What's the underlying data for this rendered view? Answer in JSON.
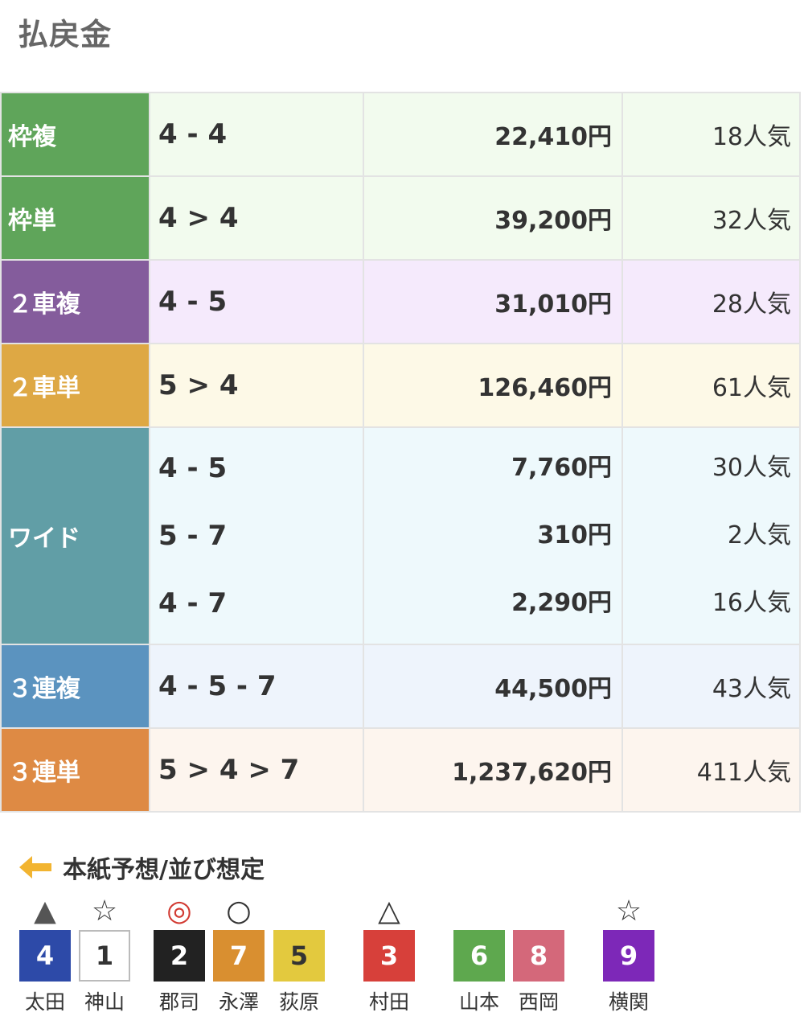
{
  "page_title": "払戻金",
  "payouts": [
    {
      "type": "枠複",
      "bg": "#5fa55a",
      "rowbg": "#f2fbee",
      "entries": [
        {
          "combo": "4 - 4",
          "amount": "22,410円",
          "popularity": "18人気"
        }
      ]
    },
    {
      "type": "枠単",
      "bg": "#5fa55a",
      "rowbg": "#f2fbee",
      "entries": [
        {
          "combo": "4 > 4",
          "amount": "39,200円",
          "popularity": "32人気"
        }
      ]
    },
    {
      "type": "２車複",
      "bg": "#845c9c",
      "rowbg": "#f5eafc",
      "entries": [
        {
          "combo": "4 - 5",
          "amount": "31,010円",
          "popularity": "28人気"
        }
      ]
    },
    {
      "type": "２車単",
      "bg": "#dea844",
      "rowbg": "#fdf9e7",
      "entries": [
        {
          "combo": "5 > 4",
          "amount": "126,460円",
          "popularity": "61人気"
        }
      ]
    },
    {
      "type": "ワイド",
      "bg": "#619ea6",
      "rowbg": "#eef9fc",
      "entries": [
        {
          "combo": "4 - 5",
          "amount": "7,760円",
          "popularity": "30人気"
        },
        {
          "combo": "5 - 7",
          "amount": "310円",
          "popularity": "2人気"
        },
        {
          "combo": "4 - 7",
          "amount": "2,290円",
          "popularity": "16人気"
        }
      ]
    },
    {
      "type": "３連複",
      "bg": "#5b93bf",
      "rowbg": "#eef4fc",
      "entries": [
        {
          "combo": "4 - 5 - 7",
          "amount": "44,500円",
          "popularity": "43人気"
        }
      ]
    },
    {
      "type": "３連単",
      "bg": "#de8a44",
      "rowbg": "#fdf5ee",
      "entries": [
        {
          "combo": "5 > 4 > 7",
          "amount": "1,237,620円",
          "popularity": "411人気"
        }
      ]
    }
  ],
  "prediction": {
    "title": "本紙予想/並び想定",
    "arrow_icon": "arrow-left-icon",
    "arrow_color": "#f2b430",
    "racers": [
      {
        "mark": "▲",
        "number": "4",
        "name": "太田",
        "bg": "#2d4aa8",
        "fg": "#ffffff",
        "border": "#2d4aa8"
      },
      {
        "mark": "☆",
        "number": "1",
        "name": "神山",
        "bg": "#ffffff",
        "fg": "#333333",
        "border": "#bbbbbb"
      },
      {
        "mark": "◎",
        "number": "2",
        "name": "郡司",
        "bg": "#222222",
        "fg": "#ffffff",
        "border": "#222222",
        "mark_color": "#d23a32"
      },
      {
        "mark": "○",
        "number": "7",
        "name": "永澤",
        "bg": "#d98f30",
        "fg": "#ffffff",
        "border": "#d98f30"
      },
      {
        "mark": "",
        "number": "5",
        "name": "荻原",
        "bg": "#e3c93e",
        "fg": "#333333",
        "border": "#e3c93e"
      },
      {
        "mark": "△",
        "number": "3",
        "name": "村田",
        "bg": "#d7403a",
        "fg": "#ffffff",
        "border": "#d7403a"
      },
      {
        "mark": "",
        "number": "6",
        "name": "山本",
        "bg": "#5ea84e",
        "fg": "#ffffff",
        "border": "#5ea84e"
      },
      {
        "mark": "",
        "number": "8",
        "name": "西岡",
        "bg": "#d4687a",
        "fg": "#ffffff",
        "border": "#d4687a"
      },
      {
        "mark": "☆",
        "number": "9",
        "name": "横関",
        "bg": "#7d28b8",
        "fg": "#ffffff",
        "border": "#7d28b8"
      }
    ]
  }
}
